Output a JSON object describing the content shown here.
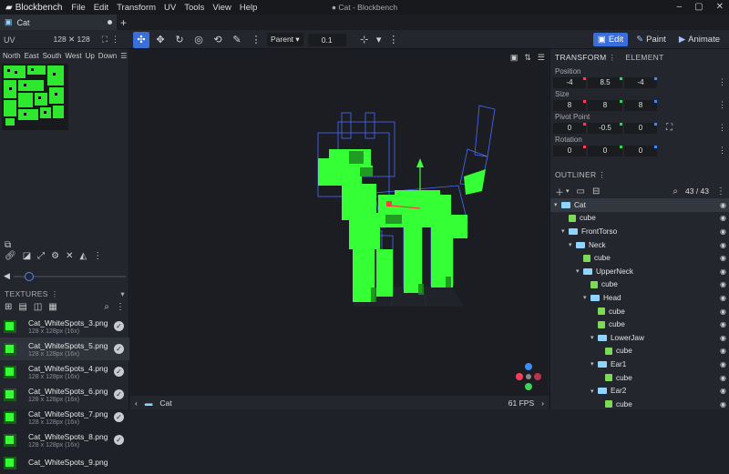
{
  "app": {
    "name": "Blockbench",
    "window_title": "● Cat - Blockbench"
  },
  "menu": [
    "File",
    "Edit",
    "Transform",
    "UV",
    "Tools",
    "View",
    "Help"
  ],
  "tab": {
    "label": "Cat"
  },
  "toolbar": {
    "pivot_mode": "Parent",
    "step_value": "0.1",
    "mode_edit": "Edit",
    "mode_paint": "Paint",
    "mode_animate": "Animate"
  },
  "uv": {
    "label": "UV",
    "size": "128 ✕ 128",
    "faces": [
      "North",
      "East",
      "South",
      "West",
      "Up",
      "Down"
    ]
  },
  "textures": {
    "header": "TEXTURES",
    "items": [
      {
        "name": "Cat_WhiteSpots_3.png",
        "size": "128 x 128px (16x)"
      },
      {
        "name": "Cat_WhiteSpots_5.png",
        "size": "128 x 128px (16x)"
      },
      {
        "name": "Cat_WhiteSpots_4.png",
        "size": "128 x 128px (16x)"
      },
      {
        "name": "Cat_WhiteSpots_6.png",
        "size": "128 x 128px (16x)"
      },
      {
        "name": "Cat_WhiteSpots_7.png",
        "size": "128 x 128px (16x)"
      },
      {
        "name": "Cat_WhiteSpots_8.png",
        "size": "128 x 128px (16x)"
      },
      {
        "name": "Cat_WhiteSpots_9.png",
        "size": ""
      }
    ]
  },
  "status": {
    "model": "Cat",
    "fps": "61 FPS"
  },
  "transform": {
    "tab_transform": "TRANSFORM",
    "tab_element": "ELEMENT",
    "position_label": "Position",
    "position": [
      "-4",
      "8.5",
      "-4"
    ],
    "size_label": "Size",
    "size": [
      "8",
      "8",
      "8"
    ],
    "pivot_label": "Pivot Point",
    "pivot": [
      "0",
      "-0.5",
      "0"
    ],
    "rotation_label": "Rotation",
    "rotation": [
      "0",
      "0",
      "0"
    ]
  },
  "outliner": {
    "header": "OUTLINER",
    "count": "43 / 43",
    "rows": [
      {
        "label": "Cat",
        "type": "group",
        "depth": 0
      },
      {
        "label": "cube",
        "type": "cube",
        "depth": 1
      },
      {
        "label": "FrontTorso",
        "type": "group",
        "depth": 1
      },
      {
        "label": "Neck",
        "type": "group",
        "depth": 2
      },
      {
        "label": "cube",
        "type": "cube",
        "depth": 3
      },
      {
        "label": "UpperNeck",
        "type": "group",
        "depth": 3
      },
      {
        "label": "cube",
        "type": "cube",
        "depth": 4
      },
      {
        "label": "Head",
        "type": "group",
        "depth": 4
      },
      {
        "label": "cube",
        "type": "cube",
        "depth": 5
      },
      {
        "label": "cube",
        "type": "cube",
        "depth": 5
      },
      {
        "label": "LowerJaw",
        "type": "group",
        "depth": 5
      },
      {
        "label": "cube",
        "type": "cube",
        "depth": 6
      },
      {
        "label": "Ear1",
        "type": "group",
        "depth": 5
      },
      {
        "label": "cube",
        "type": "cube",
        "depth": 6
      },
      {
        "label": "Ear2",
        "type": "group",
        "depth": 5
      },
      {
        "label": "cube",
        "type": "cube",
        "depth": 6
      }
    ]
  },
  "colors": {
    "accent": "#3a6ed8",
    "model_green": "#35ff35",
    "wire_blue": "#4a6cff"
  }
}
